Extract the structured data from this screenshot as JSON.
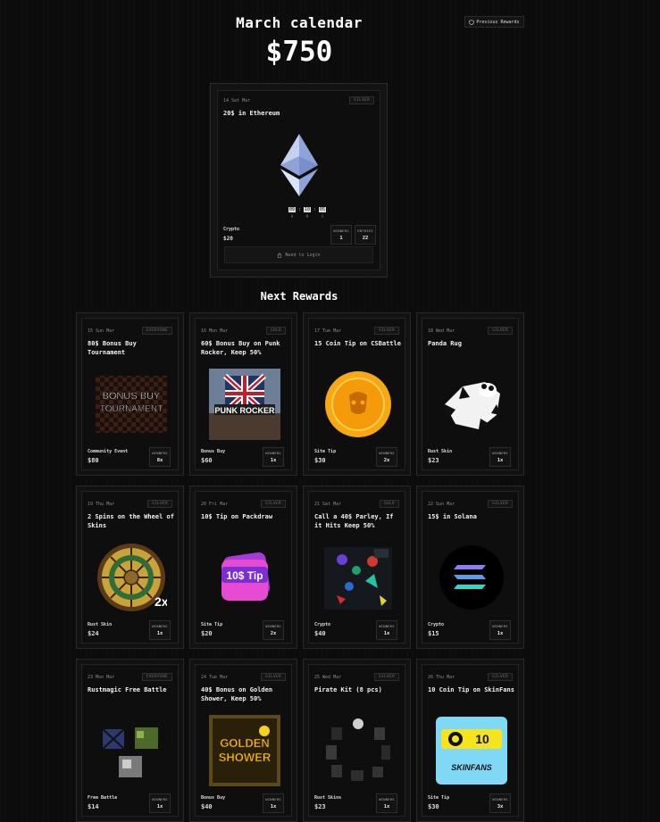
{
  "header": {
    "title": "March calendar",
    "amount": "$750",
    "prev_label": "Previous Rewards"
  },
  "featured": {
    "date": "14 Sat Mar",
    "tier": "SILVER",
    "title": "20$ in Ethereum",
    "timer": {
      "d": "09",
      "h": "10",
      "m": "05",
      "d_lbl": "H",
      "h_lbl": "M",
      "m_lbl": "S"
    },
    "category": "Crypto",
    "price": "$20",
    "winners_label": "WINNERS",
    "winners": "1",
    "entries_label": "ENTRIES",
    "entries": "22",
    "login_label": "Need to Login"
  },
  "next_title": "Next Rewards",
  "cards": [
    {
      "date": "15 Sun Mar",
      "tier": "EVERYONE",
      "title": "80$ Bonus Buy Tournament",
      "category": "Community Event",
      "price": "$80",
      "winners_label": "WINNERS",
      "winners": "8x",
      "art": "bonus-buy"
    },
    {
      "date": "16 Mon Mar",
      "tier": "GOLD",
      "title": "60$ Bonus Buy on Punk Rocker, Keep 50%",
      "category": "Bonus Buy",
      "price": "$60",
      "winners_label": "WINNERS",
      "winners": "1x",
      "art": "punk-rocker"
    },
    {
      "date": "17 Tue Mar",
      "tier": "SILVER",
      "title": "15 Coin Tip on CSBattle",
      "category": "Site Tip",
      "price": "$30",
      "winners_label": "WINNERS",
      "winners": "2x",
      "art": "coin"
    },
    {
      "date": "18 Wed Mar",
      "tier": "SILVER",
      "title": "Panda Rug",
      "category": "Rust Skin",
      "price": "$23",
      "winners_label": "WINNERS",
      "winners": "1x",
      "art": "panda"
    },
    {
      "date": "19 Thu Mar",
      "tier": "SILVER",
      "title": "2 Spins on the Wheel of Skins",
      "category": "Rust Skin",
      "price": "$24",
      "winners_label": "WINNERS",
      "winners": "1x",
      "art": "wheel"
    },
    {
      "date": "20 Fri Mar",
      "tier": "SILVER",
      "title": "10$ Tip on Packdraw",
      "category": "Site Tip",
      "price": "$20",
      "winners_label": "WINNERS",
      "winners": "2x",
      "art": "tip"
    },
    {
      "date": "21 Sat Mar",
      "tier": "GOLD",
      "title": "Call a 40$ Parley, If it Hits Keep 50%",
      "category": "Crypto",
      "price": "$40",
      "winners_label": "WINNERS",
      "winners": "1x",
      "art": "parley"
    },
    {
      "date": "22 Sun Mar",
      "tier": "SILVER",
      "title": "15$ in Solana",
      "category": "Crypto",
      "price": "$15",
      "winners_label": "WINNERS",
      "winners": "1x",
      "art": "solana"
    },
    {
      "date": "23 Mon Mar",
      "tier": "EVERYONE",
      "title": "Rustmagic Free Battle",
      "category": "Free Battle",
      "price": "$14",
      "winners_label": "WINNERS",
      "winners": "1x",
      "art": "boxes"
    },
    {
      "date": "24 Tue Mar",
      "tier": "SILVER",
      "title": "40$ Bonus on Golden Shower, Keep 50%",
      "category": "Bonus Buy",
      "price": "$40",
      "winners_label": "WINNERS",
      "winners": "1x",
      "art": "golden"
    },
    {
      "date": "25 Wed Mar",
      "tier": "SILVER",
      "title": "Pirate Kit (8 pcs)",
      "category": "Rust Skins",
      "price": "$23",
      "winners_label": "WINNERS",
      "winners": "1x",
      "art": "pirate"
    },
    {
      "date": "26 Thu Mar",
      "tier": "SILVER",
      "title": "10 Coin Tip on SkinFans",
      "category": "Site Tip",
      "price": "$30",
      "winners_label": "WINNERS",
      "winners": "3x",
      "art": "skinfans",
      "badge": "10",
      "brand": "SKINFANS"
    }
  ]
}
